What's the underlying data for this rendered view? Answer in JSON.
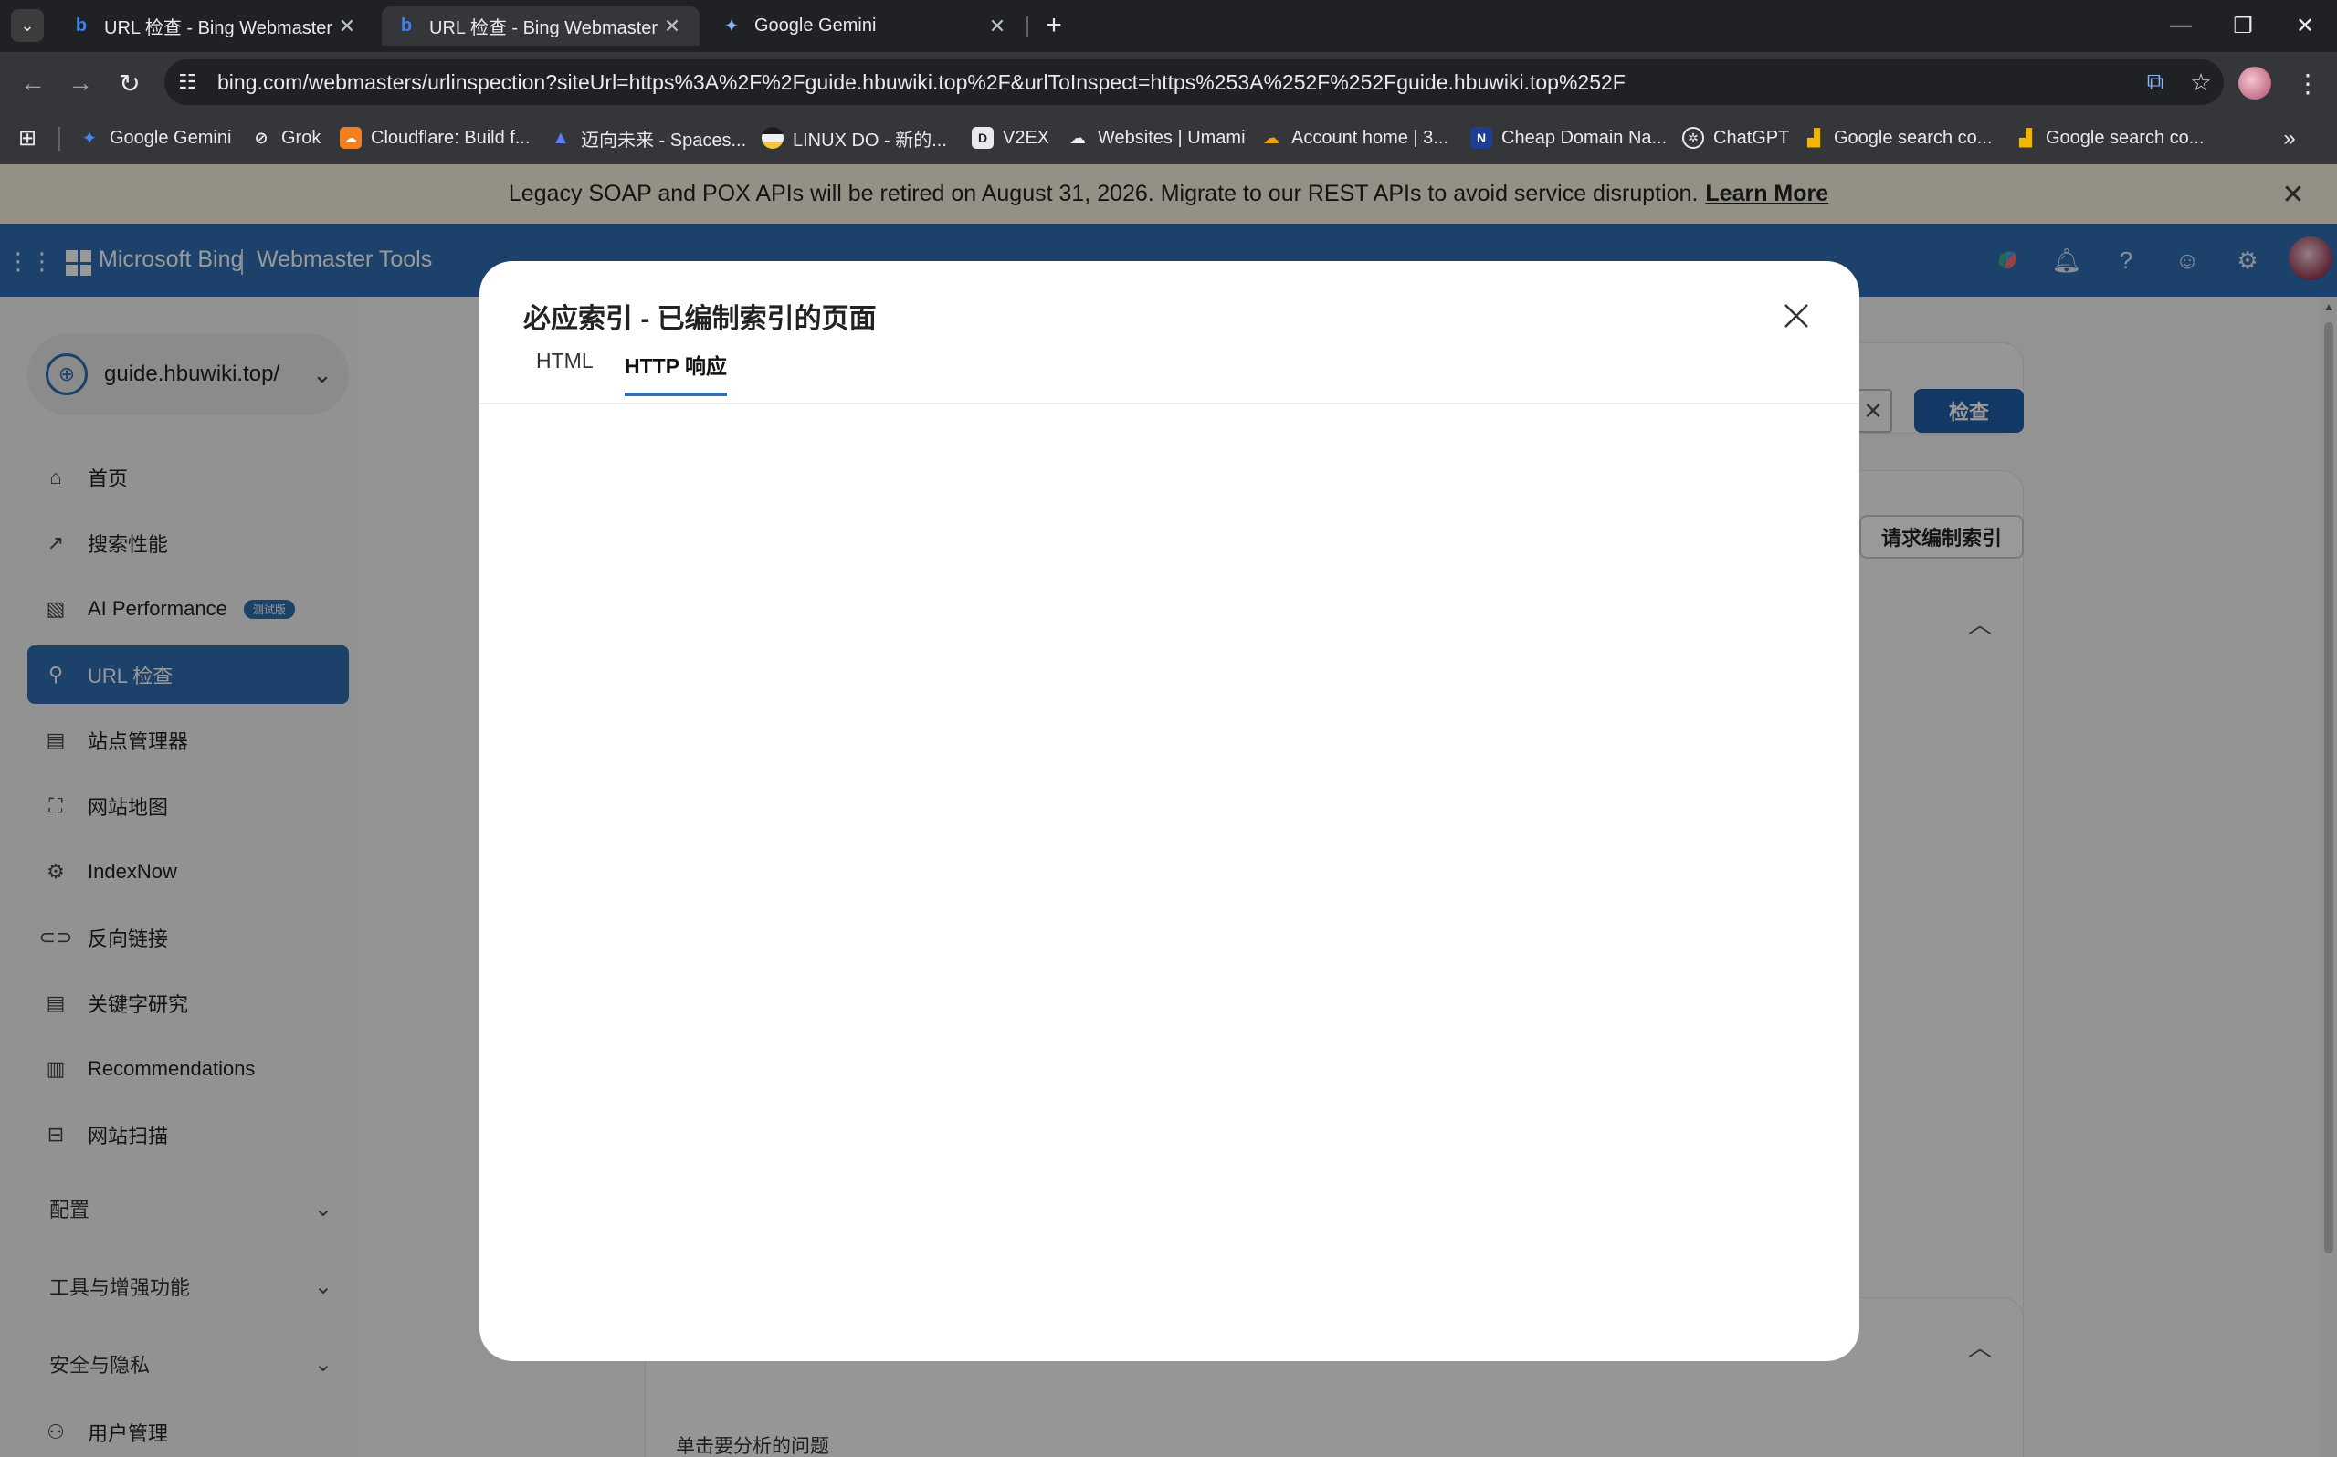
{
  "browser": {
    "tabs": [
      {
        "title": "URL 检查 - Bing Webmaster T",
        "icon": "bing-icon"
      },
      {
        "title": "URL 检查 - Bing Webmaster T",
        "icon": "bing-icon"
      },
      {
        "title": "Google Gemini",
        "icon": "gemini-icon"
      }
    ],
    "url": "bing.com/webmasters/urlinspection?siteUrl=https%3A%2F%2Fguide.hbuwiki.top%2F&urlToInspect=https%253A%252F%252Fguide.hbuwiki.top%252F",
    "bookmarks": [
      {
        "label": "Google Gemini",
        "color": "#4285f4"
      },
      {
        "label": "Grok",
        "color": "#111111"
      },
      {
        "label": "Cloudflare: Build f...",
        "color": "#f38020"
      },
      {
        "label": "迈向未来 - Spaces...",
        "color": "#3b5bdb"
      },
      {
        "label": "LINUX DO - 新的...",
        "color": "#f6c343"
      },
      {
        "label": "V2EX",
        "color": "#333333"
      },
      {
        "label": "Websites | Umami",
        "color": "#666666"
      },
      {
        "label": "Account home | 3...",
        "color": "#f59f00"
      },
      {
        "label": "Cheap Domain Na...",
        "color": "#1c3f94"
      },
      {
        "label": "ChatGPT",
        "color": "#202124"
      },
      {
        "label": "Google search co...",
        "color": "#f4b400"
      },
      {
        "label": "Google search co...",
        "color": "#f4b400"
      }
    ]
  },
  "banner": {
    "text": "Legacy SOAP and POX APIs will be retired on August 31, 2026. Migrate to our REST APIs to avoid service disruption.",
    "link": "Learn More"
  },
  "appbar": {
    "brand": "Microsoft Bing",
    "product": "Webmaster Tools",
    "accent": "#2f6fb5"
  },
  "sidebar": {
    "site": "guide.hbuwiki.top/",
    "items": [
      {
        "label": "首页"
      },
      {
        "label": "搜索性能"
      },
      {
        "label": "AI Performance",
        "badge": "测试版"
      },
      {
        "label": "URL 检查"
      },
      {
        "label": "站点管理器"
      },
      {
        "label": "网站地图"
      },
      {
        "label": "IndexNow"
      },
      {
        "label": "反向链接"
      },
      {
        "label": "关键字研究"
      },
      {
        "label": "Recommendations"
      },
      {
        "label": "网站扫描"
      }
    ],
    "groups": [
      {
        "label": "配置"
      },
      {
        "label": "工具与增强功能"
      },
      {
        "label": "安全与隐私"
      }
    ],
    "bottom_item": {
      "label": "用户管理"
    }
  },
  "main": {
    "inspect_button": "检查",
    "request_index_button": "请求编制索引",
    "issue_label": "单击要分析的问题"
  },
  "modal": {
    "title": "必应索引 - 已编制索引的页面",
    "tabs": [
      {
        "label": "HTML"
      },
      {
        "label": "HTTP 响应"
      }
    ]
  }
}
